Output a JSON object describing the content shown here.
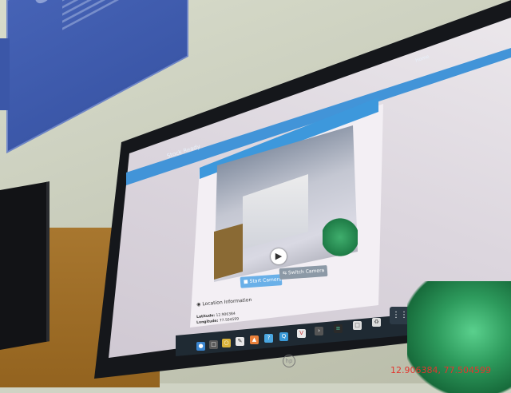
{
  "app": {
    "brand": "Stock Ready",
    "nav_link": "Home"
  },
  "camera": {
    "card_title": "",
    "start_button": "Start Camera",
    "switch_button": "Switch Camera",
    "capture_icon": "camera-shutter-icon"
  },
  "location": {
    "title": "Location Information",
    "latitude_label": "Latitude:",
    "latitude_value": "12.906384",
    "longitude_label": "Longitude:",
    "longitude_value": "77.504599"
  },
  "dock": {
    "apps_icon": "grid-icon",
    "icons": [
      "chrome-icon",
      "files-icon",
      "terminal-icon",
      "editor-icon",
      "settings-icon",
      "help-icon",
      "app-icon",
      "vlc-icon",
      "shell-icon",
      "chart-icon",
      "document-icon",
      "recycle-icon"
    ]
  },
  "overlay": {
    "gps_stamp": "12.906384, 77.504599"
  },
  "colors": {
    "header_blue": "#3d98dc",
    "start_button": "#6ab0e8",
    "switch_button": "#8c99a6",
    "gps_text": "#e2362e"
  }
}
